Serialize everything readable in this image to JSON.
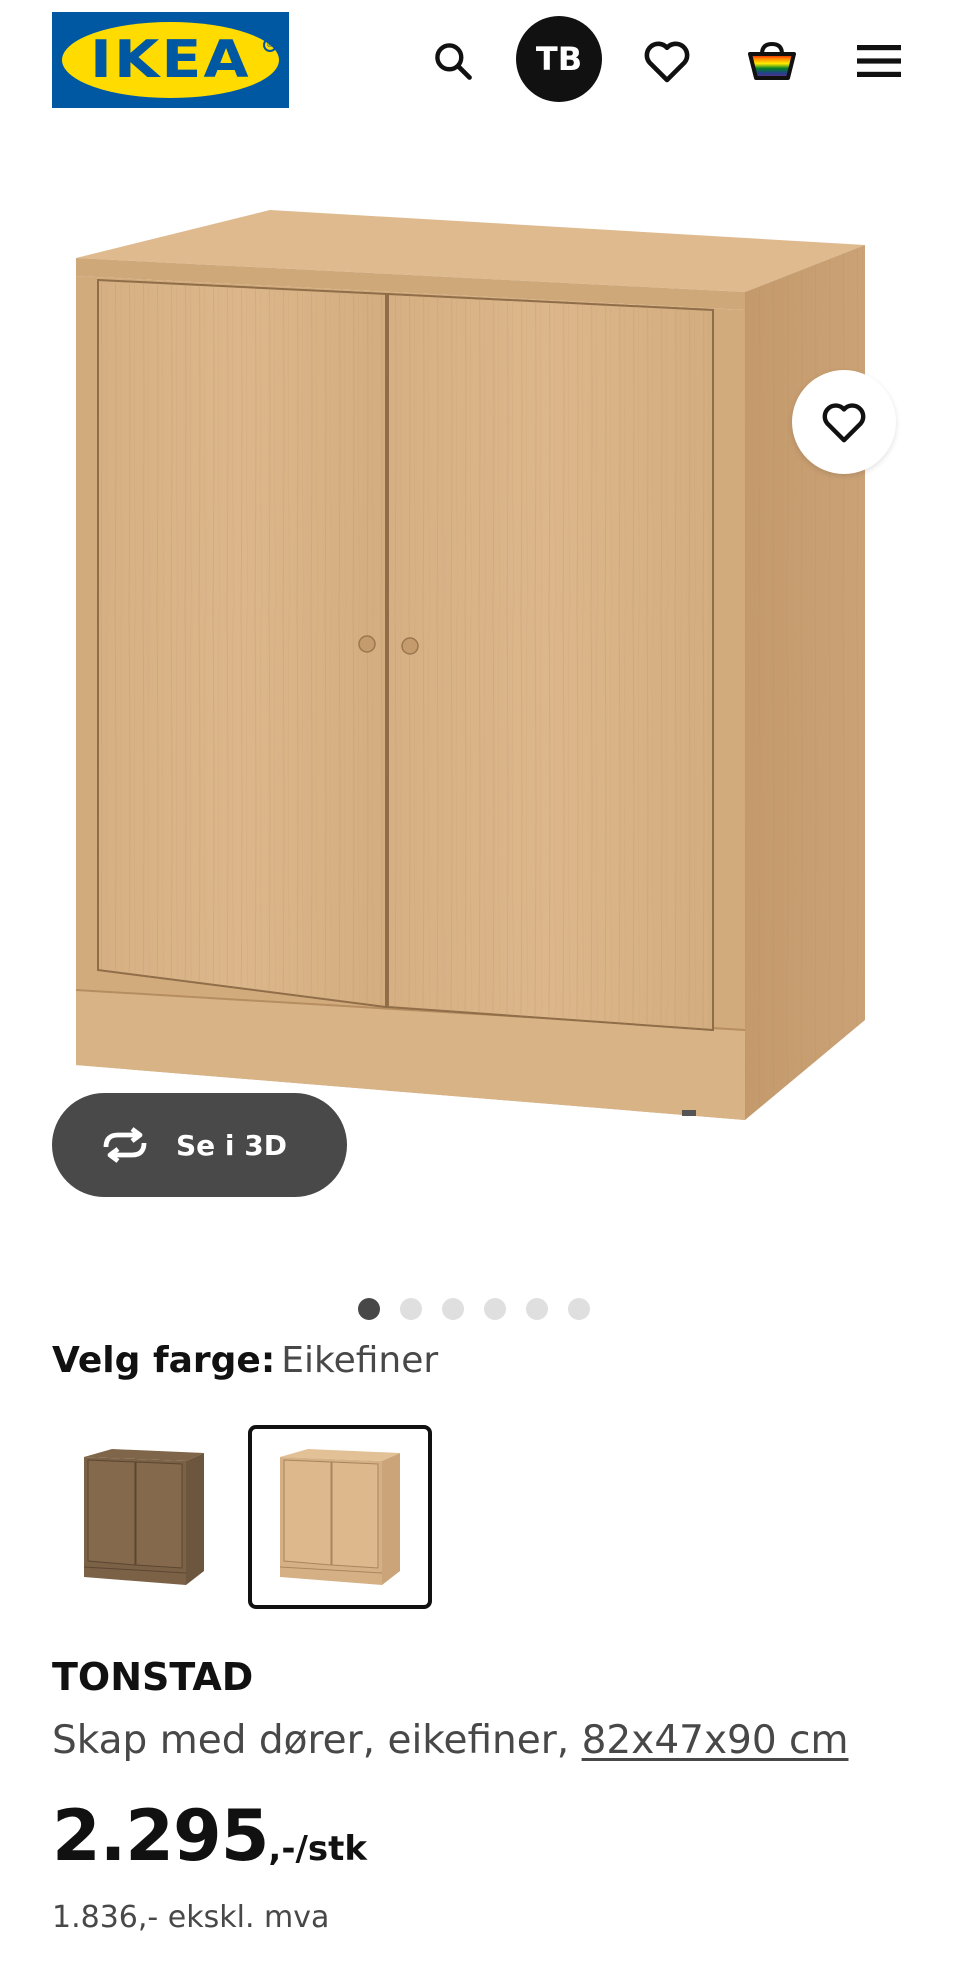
{
  "header": {
    "logo_text": "IKEA",
    "avatar_initials": "TB",
    "icons": [
      "search-icon",
      "heart-icon",
      "shopping-bag-icon",
      "menu-icon"
    ]
  },
  "gallery": {
    "view_3d_label": "Se i 3D",
    "image_count": 6,
    "active_image": 1
  },
  "color_picker": {
    "label": "Velg farge:",
    "selected": "Eikefiner",
    "options": [
      "brown-stained-option",
      "oak-veneer-option"
    ]
  },
  "product": {
    "name": "TONSTAD",
    "description": "Skap med dører, eikefiner,",
    "measurements": "82x47x90 cm",
    "price_main": "2.295",
    "price_suffix": ",-/stk",
    "price_ex_vat": "1.836,- ekskl. mva"
  },
  "colors": {
    "brand_blue": "#0058a3",
    "brand_yellow": "#ffdb00",
    "text_primary": "#111111",
    "text_secondary": "#484848"
  }
}
